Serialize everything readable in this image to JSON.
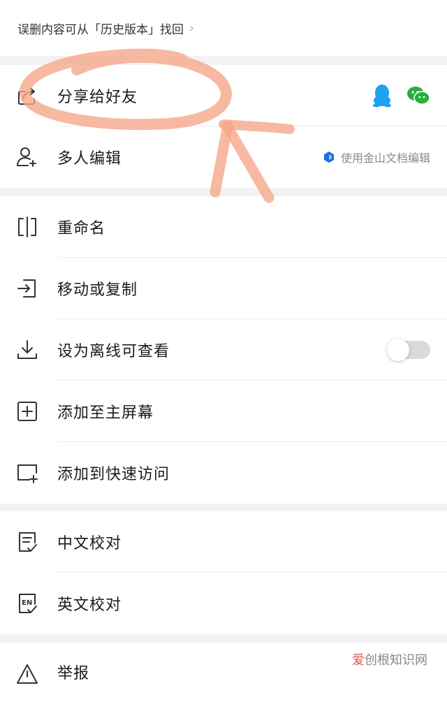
{
  "banner": {
    "text": "误删内容可从「历史版本」找回",
    "chevron": "›"
  },
  "section1": [
    {
      "id": "share",
      "label": "分享给好友",
      "icon": "share-icon"
    },
    {
      "id": "multi",
      "label": "多人编辑",
      "icon": "add-user-icon",
      "hint": "使用金山文档编辑"
    }
  ],
  "section2": [
    {
      "id": "rename",
      "label": "重命名",
      "icon": "rename-icon"
    },
    {
      "id": "move",
      "label": "移动或复制",
      "icon": "move-icon"
    },
    {
      "id": "offline",
      "label": "设为离线可查看",
      "icon": "download-icon",
      "toggle_on": false
    },
    {
      "id": "homescreen",
      "label": "添加至主屏幕",
      "icon": "add-box-icon"
    },
    {
      "id": "quick",
      "label": "添加到快速访问",
      "icon": "quick-access-icon"
    }
  ],
  "section3": [
    {
      "id": "zh_proof",
      "label": "中文校对",
      "icon": "zh-proof-icon"
    },
    {
      "id": "en_proof",
      "label": "英文校对",
      "icon": "en-proof-icon",
      "icon_text": "EN"
    }
  ],
  "section4": [
    {
      "id": "report",
      "label": "举报",
      "icon": "warning-icon"
    }
  ],
  "watermark": {
    "part1": "爱",
    "part2": "创根知识网"
  },
  "colors": {
    "qq": "#1da1f2",
    "wechat": "#2bad3e",
    "annotation": "#f5a88a",
    "kingsoft": "#1e6fd8"
  }
}
